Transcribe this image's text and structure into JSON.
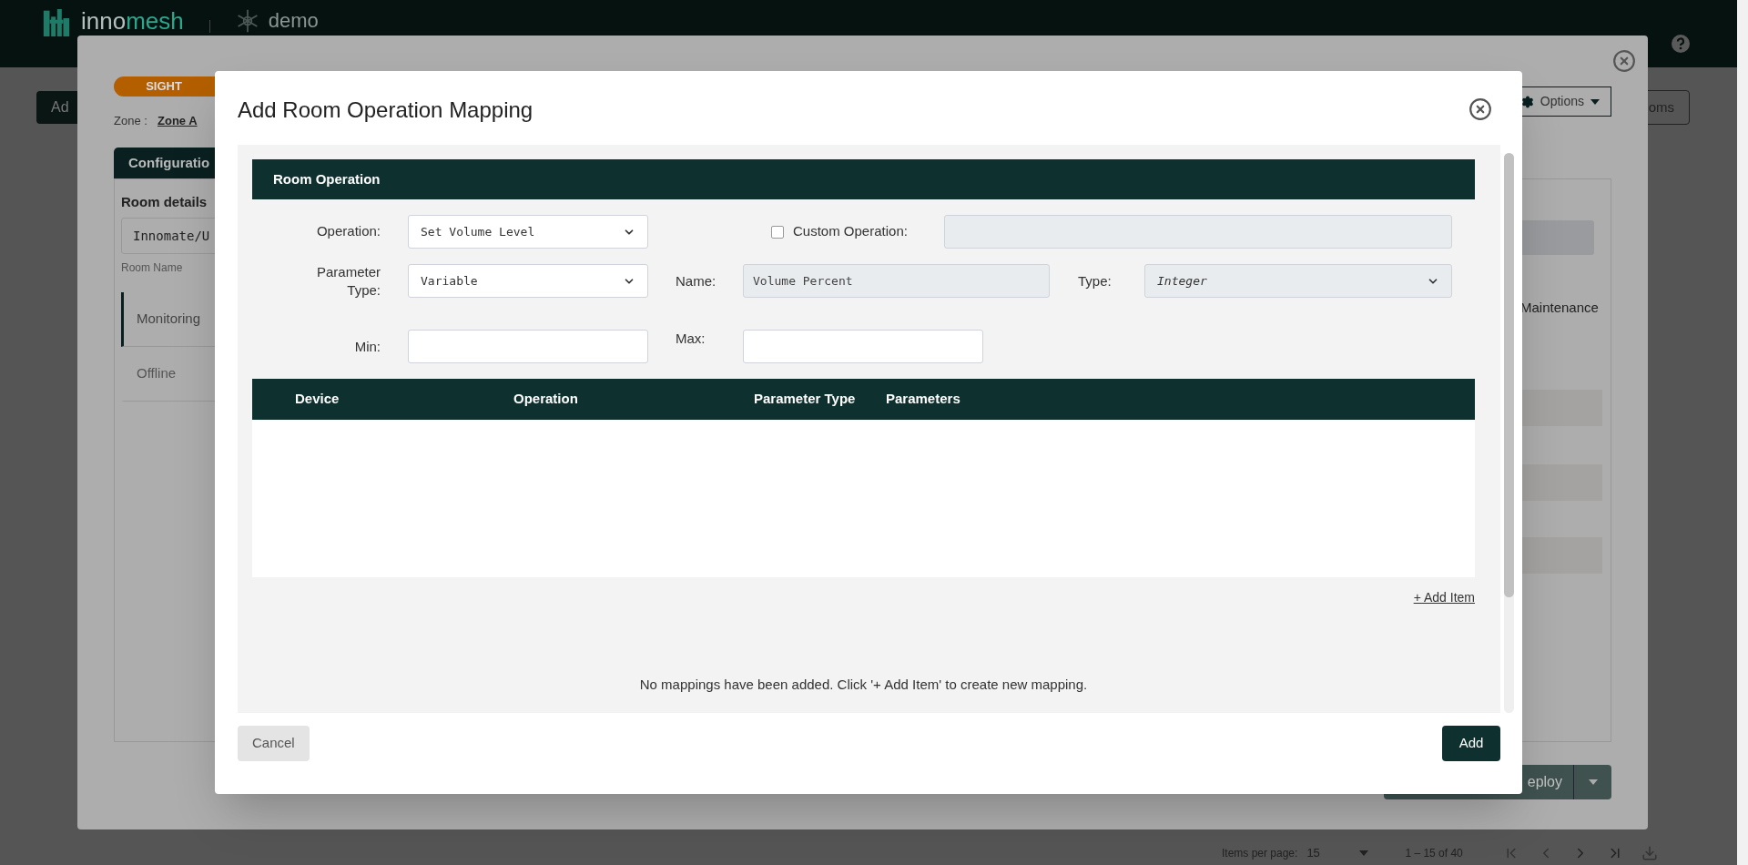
{
  "top_bar": {
    "logo": [
      "inno",
      "mesh"
    ],
    "tenant": "demo"
  },
  "background": {
    "add_button": "Ad",
    "rooms_button": "oms",
    "pagination": {
      "items_label": "Items per page:",
      "page_size": "15",
      "range": "1 – 15 of 40"
    }
  },
  "room_dialog": {
    "badge": "SIGHT",
    "zone_label": "Zone :",
    "zone": "Zone A",
    "options_button": "Options",
    "tab": "Configuratio",
    "room_details_title": "Room details",
    "room_name_value": "Innomate/U",
    "room_name_label": "Room Name",
    "side_tabs": [
      {
        "label": "Monitoring",
        "selected": true
      },
      {
        "label": "Offline",
        "selected": false
      }
    ],
    "mode_label": "Maintenance",
    "deploy_button": "eploy"
  },
  "mapping_dialog": {
    "title": "Add Room Operation Mapping",
    "section_title": "Room Operation",
    "operation": {
      "label": "Operation:",
      "value": "Set Volume Level"
    },
    "custom_operation": {
      "label": "Custom Operation:",
      "checked": false,
      "disabled": true
    },
    "parameter_type": {
      "label": "Parameter Type:",
      "value": "Variable"
    },
    "name": {
      "label": "Name:",
      "value": "Volume Percent",
      "disabled": true
    },
    "type": {
      "label": "Type:",
      "value": "Integer",
      "disabled": true
    },
    "min": {
      "label": "Min:"
    },
    "max": {
      "label": "Max:"
    },
    "table_columns": [
      "Device",
      "Operation",
      "Parameter Type",
      "Parameters"
    ],
    "add_item_link": "+ Add Item",
    "empty_message": "No mappings have been added. Click '+ Add Item' to create new mapping.",
    "cancel_button": "Cancel",
    "add_button": "Add"
  }
}
